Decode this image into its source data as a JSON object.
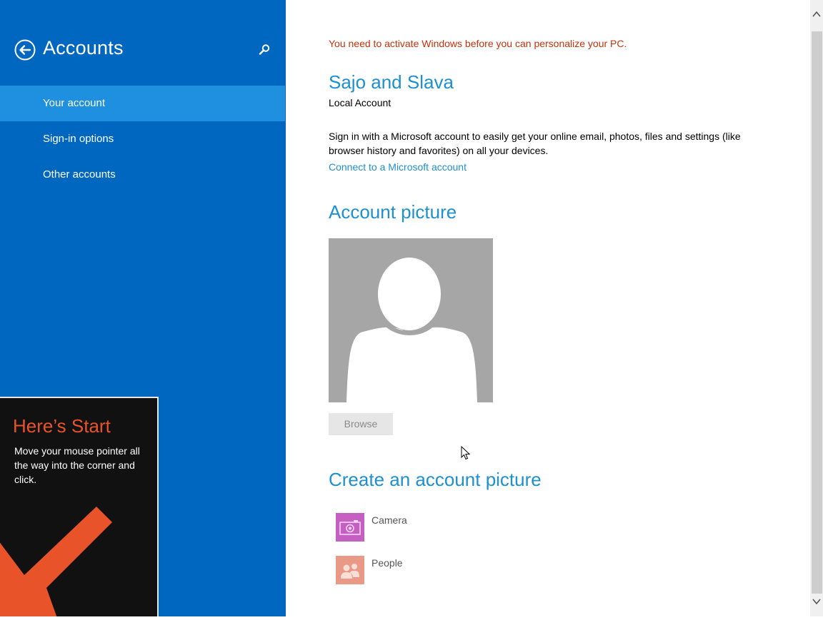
{
  "left_pane": {
    "title": "Accounts",
    "back_icon": "back-arrow-circle-icon",
    "search_icon": "search-icon",
    "nav_items": [
      {
        "label": "Your account",
        "selected": true
      },
      {
        "label": "Sign-in options",
        "selected": false
      },
      {
        "label": "Other accounts",
        "selected": false
      }
    ]
  },
  "start_tip": {
    "title": "Here’s Start",
    "text": "Move your mouse pointer all the way into the corner and click.",
    "arrow_color": "#e9532a"
  },
  "content": {
    "activation_warning": "You need to activate Windows before you can personalize your PC.",
    "account_name": "Sajo and Slava",
    "account_type": "Local Account",
    "ms_description": "Sign in with a Microsoft account to easily get your online email, photos, files and settings (like browser history and favorites) on all your devices.",
    "connect_link": "Connect to a Microsoft account",
    "picture_heading": "Account picture",
    "browse_label": "Browse",
    "create_heading": "Create an account picture",
    "apps": [
      {
        "label": "Camera",
        "icon": "camera-icon",
        "color": "#c55fc2"
      },
      {
        "label": "People",
        "icon": "people-icon",
        "color": "#e89a86"
      }
    ]
  },
  "colors": {
    "pane_blue": "#0067c0",
    "selected_blue": "#1f8fe0",
    "accent_blue": "#1e8fd1",
    "warning_red": "#c4320a"
  }
}
